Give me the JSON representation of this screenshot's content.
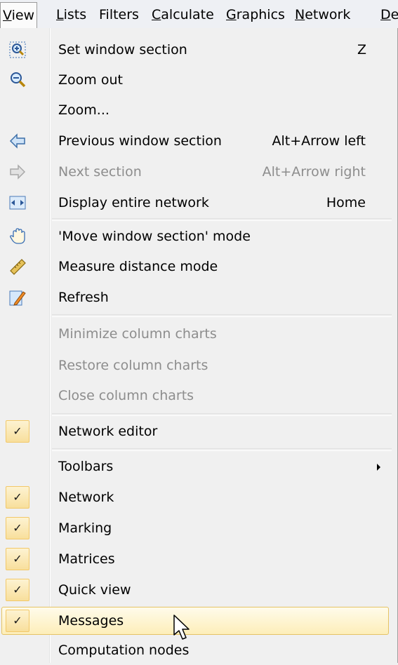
{
  "menubar": {
    "items": [
      {
        "label": "View",
        "active": true
      },
      {
        "label": "Lists"
      },
      {
        "label": "Filters"
      },
      {
        "label": "Calculate"
      },
      {
        "label": "Graphics"
      },
      {
        "label": "Network"
      },
      {
        "label": "De"
      }
    ]
  },
  "menu": {
    "items": [
      {
        "label": "Set window section",
        "shortcut": "Z",
        "icon": "zoom-in-icon"
      },
      {
        "label": "Zoom out",
        "icon": "zoom-out-icon"
      },
      {
        "label": "Zoom..."
      },
      {
        "label": "Previous window section",
        "shortcut": "Alt+Arrow left",
        "icon": "arrow-left-icon"
      },
      {
        "label": "Next section",
        "shortcut": "Alt+Arrow right",
        "icon": "arrow-right-icon",
        "disabled": true
      },
      {
        "label": "Display entire network",
        "shortcut": "Home",
        "icon": "fit-width-icon"
      },
      {
        "label": "'Move window section' mode",
        "icon": "hand-icon"
      },
      {
        "label": "Measure distance mode",
        "icon": "ruler-icon"
      },
      {
        "label": "Refresh",
        "icon": "pencil-icon"
      },
      {
        "label": "Minimize column charts",
        "disabled": true
      },
      {
        "label": "Restore column charts",
        "disabled": true
      },
      {
        "label": "Close column charts",
        "disabled": true
      },
      {
        "label": "Network editor",
        "checked": true
      },
      {
        "label": "Toolbars",
        "submenu": true
      },
      {
        "label": "Network",
        "checked": true
      },
      {
        "label": "Marking",
        "checked": true
      },
      {
        "label": "Matrices",
        "checked": true
      },
      {
        "label": "Quick view",
        "checked": true
      },
      {
        "label": "Messages",
        "checked": true,
        "highlighted": true
      },
      {
        "label": "Computation nodes"
      }
    ],
    "check_mark": "✓"
  },
  "colors": {
    "highlight_border": "#e5c365",
    "check_background": "#fdf3d2",
    "disabled_text": "#8d8d8d"
  }
}
